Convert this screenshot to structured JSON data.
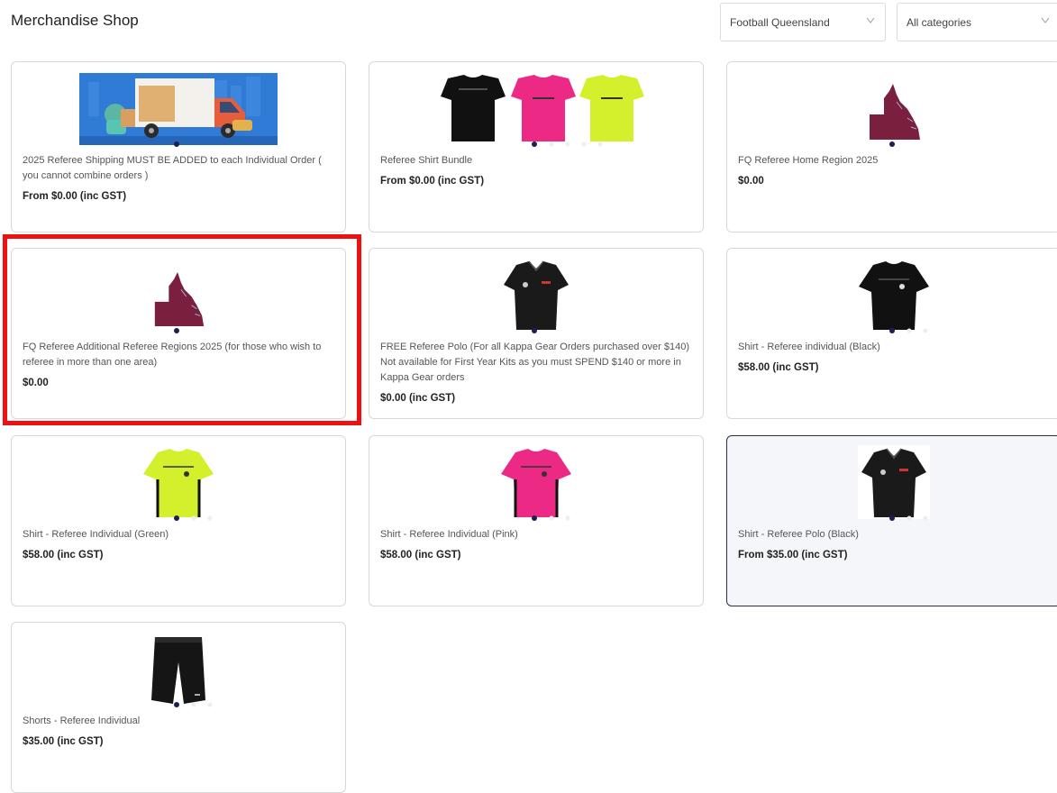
{
  "header": {
    "title": "Merchandise Shop",
    "org_select": "Football Queensland",
    "category_select": "All categories"
  },
  "products": [
    {
      "name": "2025 Referee Shipping MUST BE ADDED to each Individual Order ( you cannot combine orders )",
      "price": "From $0.00 (inc GST)",
      "image": "shipping-truck-banner"
    },
    {
      "name": "Referee Shirt Bundle",
      "price": "From $0.00 (inc GST)",
      "image": "three-shirts-black-pink-green"
    },
    {
      "name": "FQ Referee Home Region 2025",
      "price": "$0.00",
      "image": "queensland-map"
    },
    {
      "name": "FQ Referee Additional Referee Regions 2025 (for those who wish to referee in more than one area)",
      "price": "$0.00",
      "image": "queensland-map"
    },
    {
      "name": "FREE Referee Polo (For all Kappa Gear Orders purchased over $140) Not available for First Year Kits as you must SPEND $140 or more in Kappa Gear orders",
      "price": "$0.00 (inc GST)",
      "image": "black-polo"
    },
    {
      "name": "Shirt - Referee individual (Black)",
      "price": "$58.00 (inc GST)",
      "image": "black-shirt"
    },
    {
      "name": "Shirt - Referee Individual (Green)",
      "price": "$58.00 (inc GST)",
      "image": "green-shirt"
    },
    {
      "name": "Shirt - Referee Individual (Pink)",
      "price": "$58.00 (inc GST)",
      "image": "pink-shirt"
    },
    {
      "name": "Shirt - Referee Polo (Black)",
      "price": "From $35.00 (inc GST)",
      "image": "black-polo"
    },
    {
      "name": "Shorts - Referee Individual",
      "price": "$35.00 (inc GST)",
      "image": "black-shorts"
    }
  ],
  "colors": {
    "highlight": "#ee1111",
    "shirt_black": "#111111",
    "shirt_pink": "#ec2a86",
    "shirt_green": "#d4f02c",
    "qld_maroon": "#7a1f3d",
    "hover_border": "#2a2f45"
  }
}
